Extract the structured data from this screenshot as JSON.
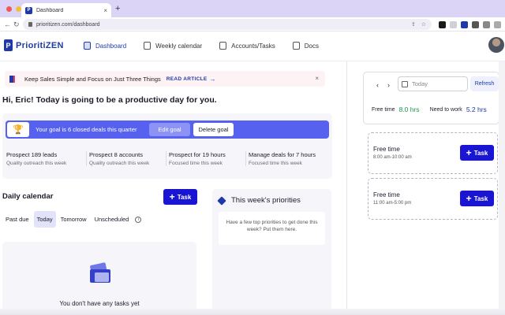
{
  "browser": {
    "tab_title": "Dashboard",
    "tab_favicon": "P",
    "tab_close": "×",
    "new_tab": "+",
    "url": "prioritizen.com/dashboard",
    "colors": {
      "tabbar": "#dcd4f6",
      "dot_red": "#ee5a4f",
      "dot_yellow": "#f4bd3c",
      "dot_green": "#5ec84a"
    }
  },
  "header": {
    "logo_mark": "P",
    "logo_text": "PrioritiZEN",
    "nav": [
      {
        "label": "Dashboard",
        "icon": "dashboard-icon",
        "active": true
      },
      {
        "label": "Weekly calendar",
        "icon": "calendar-icon",
        "active": false
      },
      {
        "label": "Accounts/Tasks",
        "icon": "accounts-icon",
        "active": false
      },
      {
        "label": "Docs",
        "icon": "docs-icon",
        "active": false
      }
    ]
  },
  "banner": {
    "text": "Keep Sales Simple and Focus on Just Three Things",
    "link": "READ ARTICLE",
    "arrow": "→",
    "close": "×"
  },
  "greeting": "Hi, Eric! Today is going to be a productive day for you.",
  "goal": {
    "text": "Your goal is 6 closed deals this quarter",
    "edit_label": "Edit goal",
    "delete_label": "Delete goal",
    "trophy": "🏆",
    "stats": [
      {
        "title": "Prospect 189 leads",
        "sub": "Quality outreach this week"
      },
      {
        "title": "Prospect 8 accounts",
        "sub": "Quality outreach this week"
      },
      {
        "title": "Prospect for 19 hours",
        "sub": "Focused time this week"
      },
      {
        "title": "Manage deals for 7 hours",
        "sub": "Focused time this week"
      }
    ]
  },
  "daily": {
    "title": "Daily calendar",
    "task_label": "Task",
    "plus": "+",
    "tabs": [
      "Past due",
      "Today",
      "Tomorrow",
      "Unscheduled"
    ],
    "active_tab": "Today",
    "info": "i",
    "empty_text": "You don't have any tasks yet"
  },
  "priorities": {
    "title": "This week's priorities",
    "body": "Have a few top priorities to get done this week? Put them here."
  },
  "schedule": {
    "prev": "‹",
    "next": "›",
    "date_placeholder": "Today",
    "refresh_label": "Refresh",
    "free_time_label": "Free time",
    "free_time_value": "8.0 hrs",
    "need_label": "Need to work",
    "need_value": "5.2 hrs",
    "slots": [
      {
        "title": "Free time",
        "time": "8:00 am-10:00 am",
        "task_label": "Task"
      },
      {
        "title": "Free time",
        "time": "11:00 am-5:00 pm",
        "task_label": "Task"
      }
    ]
  }
}
